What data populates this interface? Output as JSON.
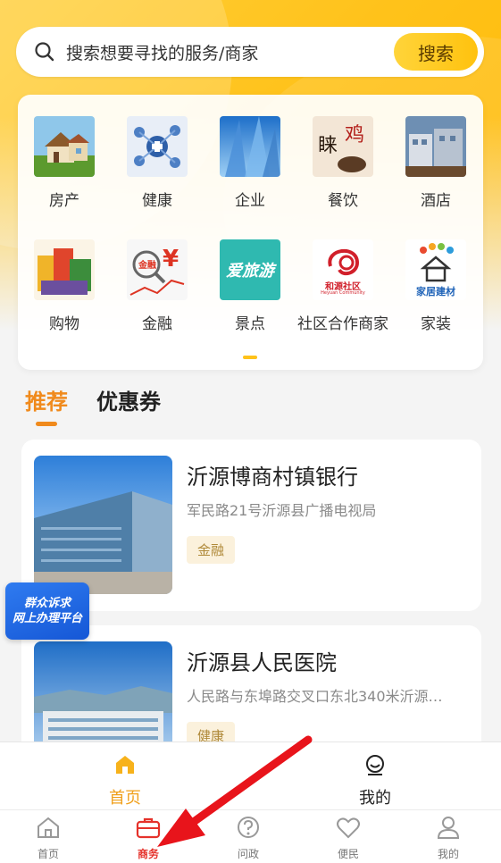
{
  "search": {
    "placeholder": "搜索想要寻找的服务/商家",
    "button_label": "搜索"
  },
  "categories": [
    {
      "label": "房产",
      "icon": "house-icon"
    },
    {
      "label": "健康",
      "icon": "health-icon"
    },
    {
      "label": "企业",
      "icon": "building-icon"
    },
    {
      "label": "餐饮",
      "icon": "food-icon"
    },
    {
      "label": "酒店",
      "icon": "hotel-icon"
    },
    {
      "label": "购物",
      "icon": "shopping-icon"
    },
    {
      "label": "金融",
      "icon": "finance-icon"
    },
    {
      "label": "景点",
      "icon": "travel-icon"
    },
    {
      "label": "社区合作商家",
      "icon": "community-icon"
    },
    {
      "label": "家装",
      "icon": "home-decor-icon"
    }
  ],
  "category_images": {
    "travel_text": "爱旅游",
    "community_text": "和源社区",
    "community_en": "Heyuan Community",
    "decor_text": "家居建材"
  },
  "tabs": [
    {
      "label": "推荐"
    },
    {
      "label": "优惠券"
    }
  ],
  "listings": [
    {
      "title": "沂源博商村镇银行",
      "address": "军民路21号沂源县广播电视局",
      "tag": "金融"
    },
    {
      "title": "沂源县人民医院",
      "address": "人民路与东埠路交叉口东北340米沂源…",
      "tag": "健康"
    }
  ],
  "float_badge": {
    "line1": "群众诉求",
    "line2": "网上办理平台"
  },
  "inner_nav": [
    {
      "label": "首页",
      "icon": "home-filled-icon"
    },
    {
      "label": "我的",
      "icon": "smile-icon"
    }
  ],
  "bottom_nav": [
    {
      "label": "首页",
      "icon": "home-icon"
    },
    {
      "label": "商务",
      "icon": "briefcase-icon"
    },
    {
      "label": "问政",
      "icon": "question-icon"
    },
    {
      "label": "便民",
      "icon": "heart-icon"
    },
    {
      "label": "我的",
      "icon": "user-icon"
    }
  ],
  "colors": {
    "accent": "#ffc21a",
    "tab_active": "#f08a1c",
    "bottom_active": "#e5322b",
    "tag_text": "#b08a3a"
  }
}
